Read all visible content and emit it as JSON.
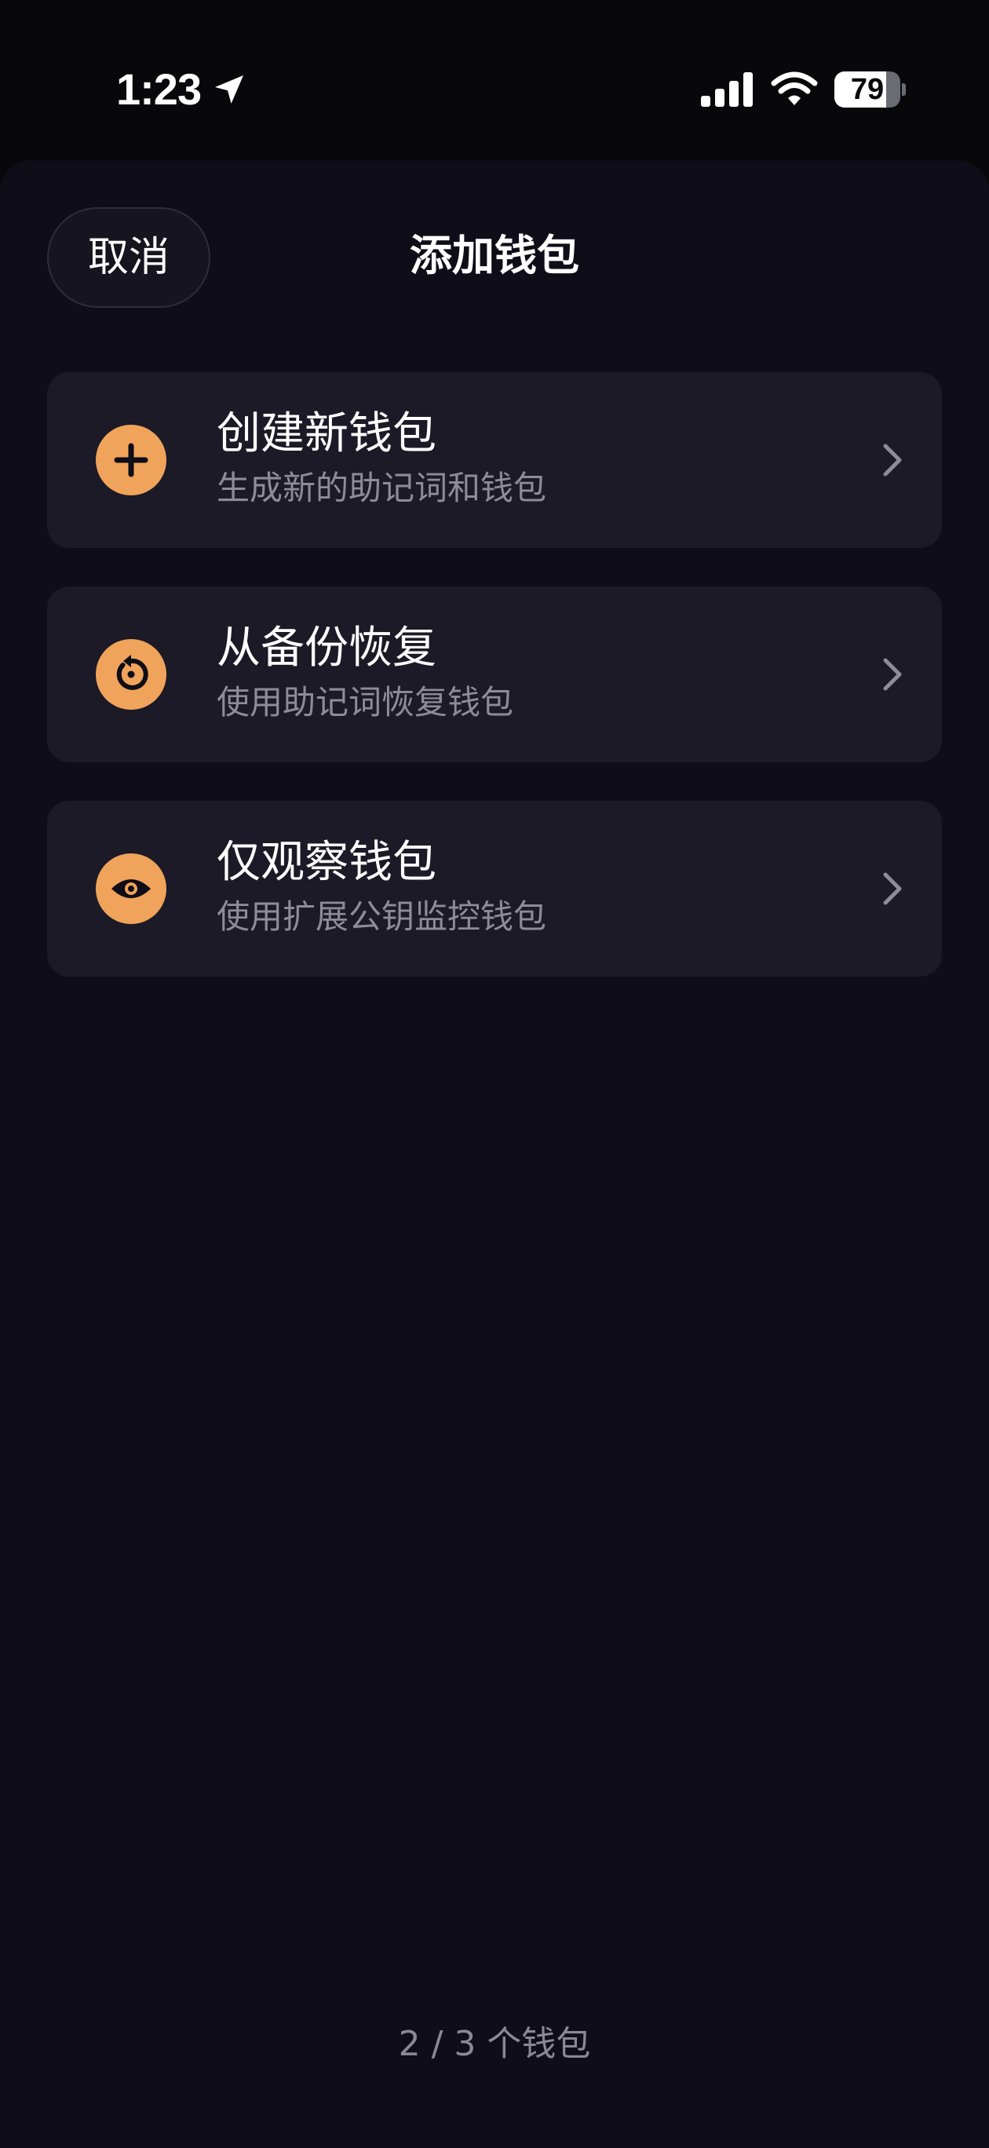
{
  "status_bar": {
    "time": "1:23",
    "battery_percent": 79,
    "battery_label": "79",
    "icons": [
      "location-arrow-icon",
      "cellular-signal-icon",
      "wifi-icon",
      "battery-icon"
    ]
  },
  "header": {
    "cancel_label": "取消",
    "title": "添加钱包"
  },
  "options": [
    {
      "icon": "plus-icon",
      "title": "创建新钱包",
      "subtitle": "生成新的助记词和钱包"
    },
    {
      "icon": "restore-icon",
      "title": "从备份恢复",
      "subtitle": "使用助记词恢复钱包"
    },
    {
      "icon": "eye-icon",
      "title": "仅观察钱包",
      "subtitle": "使用扩展公钥监控钱包"
    }
  ],
  "footer": {
    "wallet_count": "2 / 3 个钱包"
  },
  "colors": {
    "accent": "#f0a35a",
    "background": "#0e0d18",
    "card": "#1b1a26",
    "secondary_text": "#8e8c99"
  }
}
